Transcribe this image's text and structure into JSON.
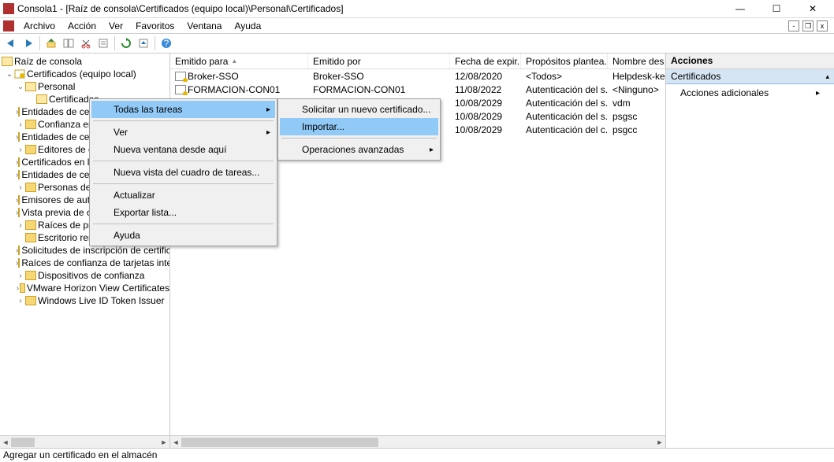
{
  "title": "Consola1 - [Raíz de consola\\Certificados (equipo local)\\Personal\\Certificados]",
  "menubar": [
    "Archivo",
    "Acción",
    "Ver",
    "Favoritos",
    "Ventana",
    "Ayuda"
  ],
  "tree": {
    "root": "Raíz de consola",
    "snapin": "Certificados (equipo local)",
    "personal": "Personal",
    "certificados": "Certificados",
    "others": [
      "Entidades de certificación raíz de confianza",
      "Confianza empresarial",
      "Entidades de certificación intermedias",
      "Editores de confianza",
      "Certificados en los que no se confía",
      "Entidades de certificación raíz de terceros",
      "Personas de confianza",
      "Emisores de autenticación de cliente",
      "Vista previa de compilación de certificados",
      "Raíces de prueba",
      "Escritorio remoto",
      "Solicitudes de inscripción de certificado",
      "Raíces de confianza de tarjetas inteligentes",
      "Dispositivos de confianza",
      "VMware Horizon View Certificates",
      "Windows Live ID Token Issuer"
    ]
  },
  "columns": {
    "emitido_para": "Emitido para",
    "emitido_por": "Emitido por",
    "fecha": "Fecha de expir...",
    "propositos": "Propósitos plantea...",
    "nombre": "Nombre desc"
  },
  "rows": [
    {
      "para": "Broker-SSO",
      "por": "Broker-SSO",
      "fecha": "12/08/2020",
      "prop": "<Todos>",
      "nom": "Helpdesk-key"
    },
    {
      "para": "FORMACION-CON01",
      "por": "FORMACION-CON01",
      "fecha": "11/08/2022",
      "prop": "Autenticación del s...",
      "nom": "<Ninguno>"
    },
    {
      "para": "",
      "por": "",
      "fecha": "10/08/2029",
      "prop": "Autenticación del s...",
      "nom": "vdm"
    },
    {
      "para": "",
      "por": "",
      "fecha": "10/08/2029",
      "prop": "Autenticación del s...",
      "nom": "psgsc"
    },
    {
      "para": "",
      "por": "",
      "fecha": "10/08/2029",
      "prop": "Autenticación del c...",
      "nom": "psgcc"
    }
  ],
  "actions": {
    "header": "Acciones",
    "section": "Certificados",
    "item1": "Acciones adicionales"
  },
  "ctx1": {
    "todas": "Todas las tareas",
    "ver": "Ver",
    "nueva_ventana": "Nueva ventana desde aquí",
    "nueva_vista": "Nueva vista del cuadro de tareas...",
    "actualizar": "Actualizar",
    "exportar": "Exportar lista...",
    "ayuda": "Ayuda"
  },
  "ctx2": {
    "solicitar": "Solicitar un nuevo certificado...",
    "importar": "Importar...",
    "avanzadas": "Operaciones avanzadas"
  },
  "statusbar": "Agregar un certificado en el almacén"
}
